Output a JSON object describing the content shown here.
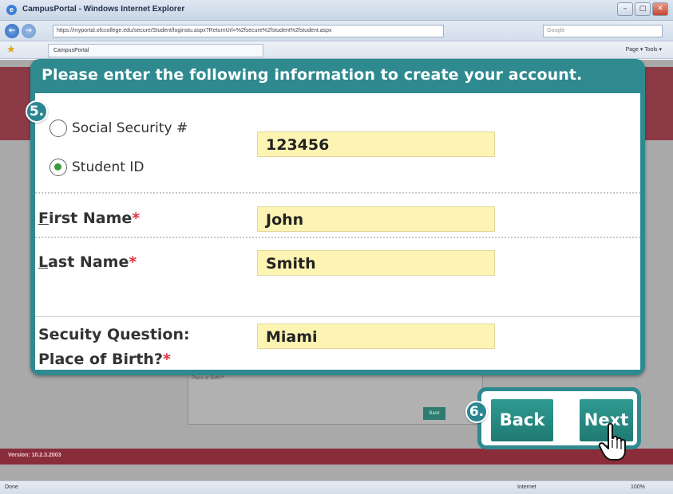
{
  "browser": {
    "window_title": "CampusPortal - Windows Internet Explorer",
    "url": "https://myportal.ofccollege.edu/secure/Student/loginstu.aspx?ReturnUrl=%2fsecure%2fstudent%2fstudent.aspx",
    "tab_title": "CampusPortal",
    "search_placeholder": "Google",
    "command_bar": "Page ▾  Tools ▾",
    "status_left": "Done",
    "status_zone": "Internet",
    "status_zoom": "100%",
    "version": "Version: 10.2.3.2003",
    "bg_field_label": "Place of Birth?*",
    "bg_back_label": "Back"
  },
  "form": {
    "header": "Please enter the following information to create your account.",
    "step_identity": "5.",
    "id_options": [
      {
        "label": "Social Security #",
        "selected": false
      },
      {
        "label": "Student ID",
        "selected": true
      }
    ],
    "id_value": "123456",
    "first_name": {
      "prefix": "",
      "accel": "F",
      "rest": "irst Name",
      "required_mark": "*",
      "value": "John"
    },
    "last_name": {
      "accel": "L",
      "rest": "ast Name",
      "required_mark": "*",
      "value": "Smith"
    },
    "security": {
      "line1": "Secuity Question:",
      "line2": "Place of Birth?",
      "required_mark": "*",
      "value": "Miami"
    }
  },
  "buttons": {
    "step": "6.",
    "back": "Back",
    "next": "Next"
  },
  "colors": {
    "accent_teal": "#2e8a8f",
    "field_fill": "#fdf4b4",
    "required_red": "#d9363e",
    "maroon": "#8c3b46"
  },
  "icons": {
    "cursor": "hand-pointer-icon",
    "radio_checked": "radio-checked-icon",
    "radio_unchecked": "radio-unchecked-icon"
  }
}
